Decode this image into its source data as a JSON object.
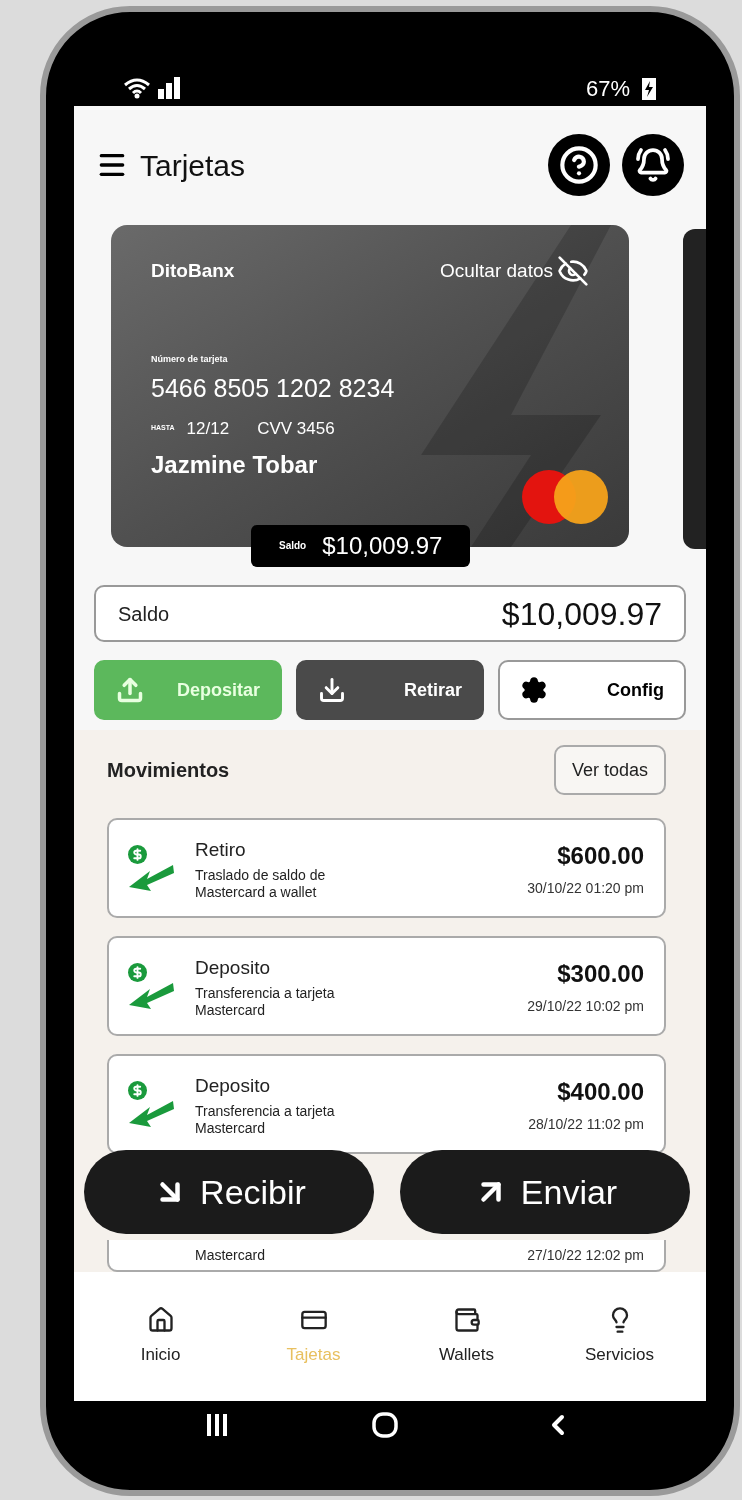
{
  "status_bar": {
    "battery": "67%"
  },
  "header": {
    "title": "Tarjetas"
  },
  "card": {
    "bank": "DitoBanx",
    "hide_label": "Ocultar datos",
    "number_label": "Número de tarjeta",
    "number": "5466 8505 1202 8234",
    "expiry_label": "HASTA",
    "expiry": "12/12",
    "cvv": "CVV 3456",
    "holder": "Jazmine Tobar",
    "balance_label": "Saldo",
    "balance": "$10,009.97"
  },
  "balance": {
    "label": "Saldo",
    "value": "$10,009.97"
  },
  "actions": [
    {
      "kind": "deposit",
      "label": "Depositar"
    },
    {
      "kind": "withdraw",
      "label": "Retirar"
    },
    {
      "kind": "config",
      "label": "Config"
    }
  ],
  "movements": {
    "title": "Movimientos",
    "see_all": "Ver todas",
    "items": [
      {
        "title": "Retiro",
        "description": "Traslado de saldo de Mastercard a wallet",
        "amount": "$600.00",
        "date": "30/10/22 01:20 pm"
      },
      {
        "title": "Deposito",
        "description": "Transferencia a tarjeta Mastercard",
        "amount": "$300.00",
        "date": "29/10/22 10:02 pm"
      },
      {
        "title": "Deposito",
        "description": "Transferencia a tarjeta Mastercard",
        "amount": "$400.00",
        "date": "28/10/22 11:02 pm"
      },
      {
        "description": "Mastercard",
        "date": "27/10/22 12:02 pm"
      }
    ]
  },
  "floating_buttons": [
    {
      "kind": "receive",
      "label": "Recibir"
    },
    {
      "kind": "send",
      "label": "Enviar"
    }
  ],
  "bottom_nav": [
    {
      "kind": "home",
      "label": "Inicio",
      "selected": false
    },
    {
      "kind": "card",
      "label": "Tajetas",
      "selected": true
    },
    {
      "kind": "wallet",
      "label": "Wallets",
      "selected": false
    },
    {
      "kind": "bulb",
      "label": "Servicios",
      "selected": false
    }
  ]
}
